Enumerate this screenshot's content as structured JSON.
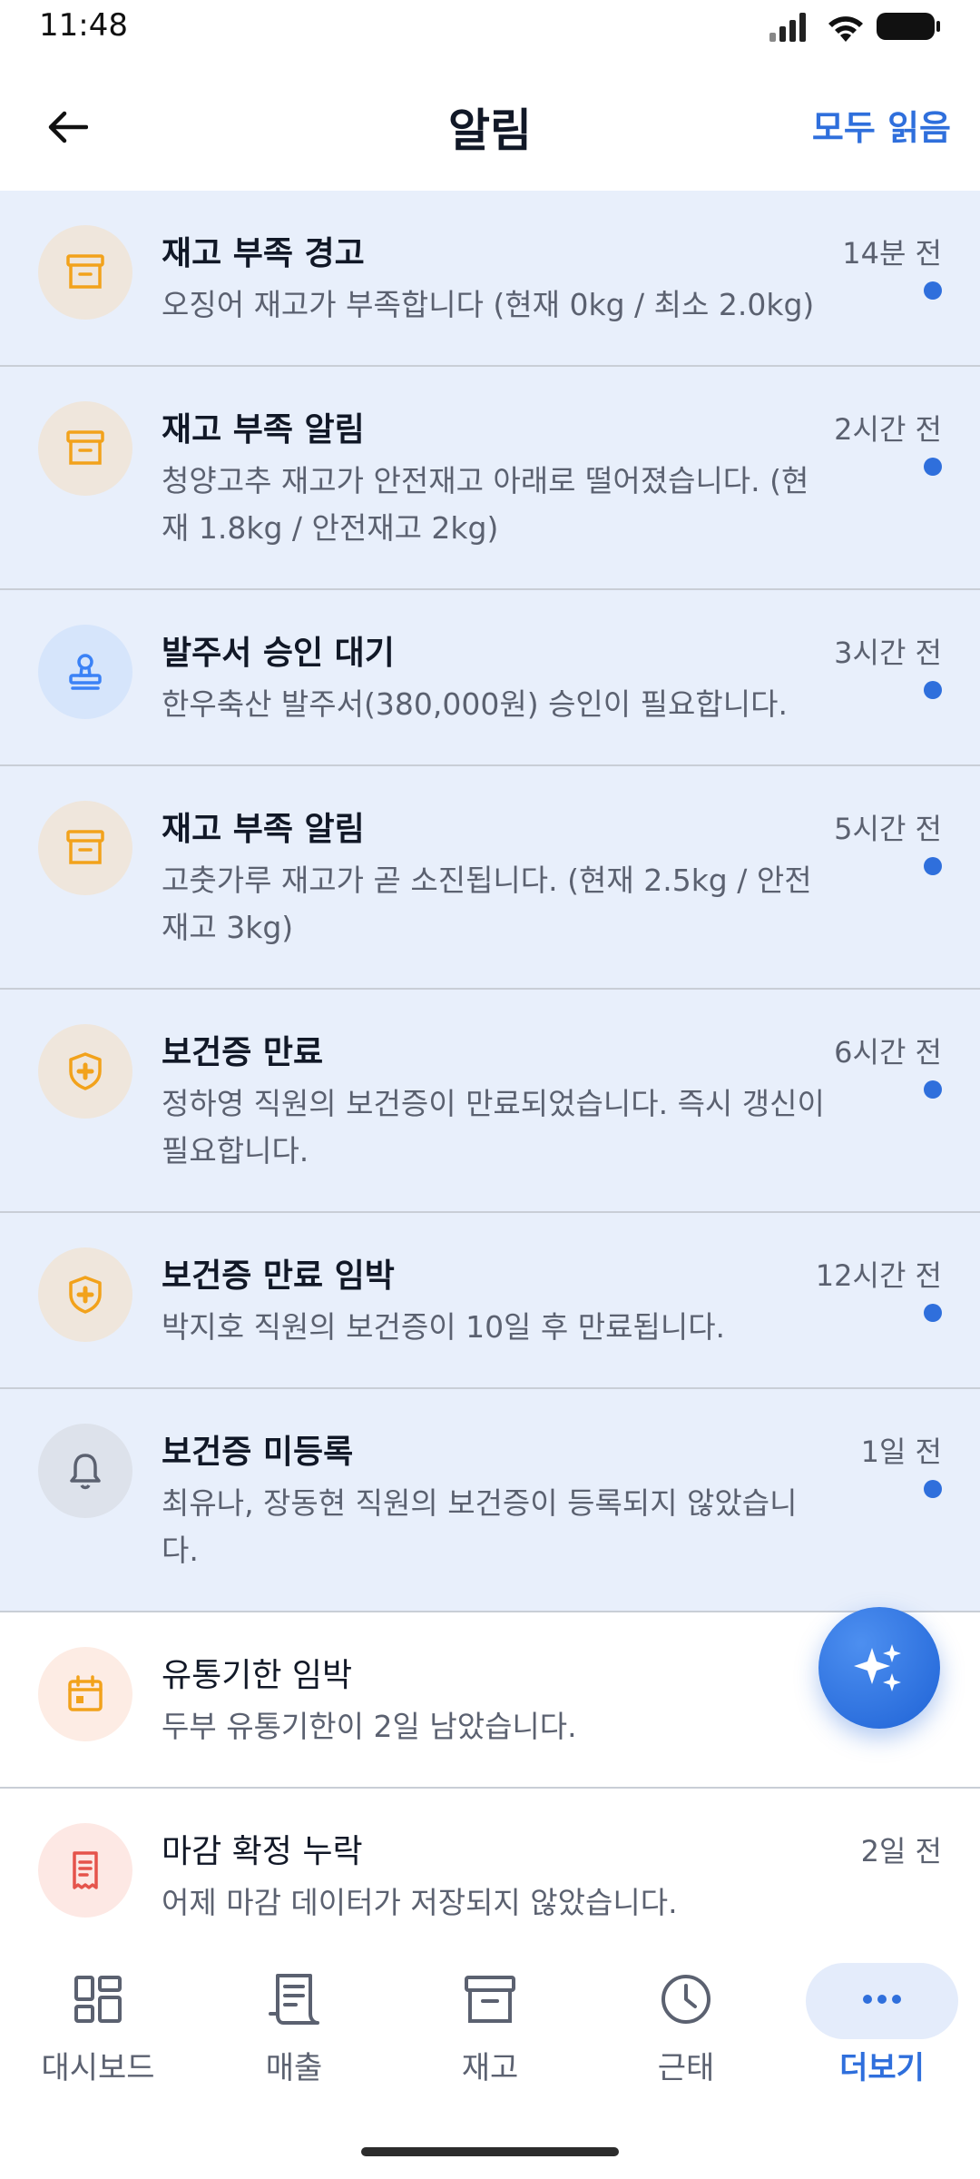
{
  "status": {
    "time": "11:48"
  },
  "appbar": {
    "title": "알림",
    "read_all": "모두 읽음"
  },
  "notifications": [
    {
      "title": "재고 부족 경고",
      "message": "오징어 재고가 부족합니다 (현재 0kg / 최소 2.0kg)",
      "time": "14분 전",
      "icon": "archive-icon",
      "state": "unread"
    },
    {
      "title": "재고 부족 알림",
      "message": "청양고추 재고가 안전재고 아래로 떨어졌습니다. (현재 1.8kg / 안전재고 2kg)",
      "time": "2시간 전",
      "icon": "archive-icon",
      "state": "unread"
    },
    {
      "title": "발주서 승인 대기",
      "message": "한우축산 발주서(380,000원) 승인이 필요합니다.",
      "time": "3시간 전",
      "icon": "stamp-icon",
      "state": "unread"
    },
    {
      "title": "재고 부족 알림",
      "message": "고춧가루 재고가 곧 소진됩니다. (현재 2.5kg / 안전재고 3kg)",
      "time": "5시간 전",
      "icon": "archive-icon",
      "state": "unread"
    },
    {
      "title": "보건증 만료",
      "message": "정하영 직원의 보건증이 만료되었습니다. 즉시 갱신이 필요합니다.",
      "time": "6시간 전",
      "icon": "shield-plus-icon",
      "state": "unread"
    },
    {
      "title": "보건증 만료 임박",
      "message": "박지호 직원의 보건증이 10일 후 만료됩니다.",
      "time": "12시간 전",
      "icon": "shield-plus-icon",
      "state": "unread"
    },
    {
      "title": "보건증 미등록",
      "message": "최유나, 장동현 직원의 보건증이 등록되지 않았습니다.",
      "time": "1일 전",
      "icon": "bell-icon",
      "state": "unread"
    },
    {
      "title": "유통기한 임박",
      "message": "두부 유통기한이 2일 남았습니다.",
      "time": "",
      "icon": "calendar-icon",
      "state": "read"
    },
    {
      "title": "마감 확정 누락",
      "message": "어제 마감 데이터가 저장되지 않았습니다.",
      "time": "2일 전",
      "icon": "receipt-icon",
      "state": "read"
    }
  ],
  "bottom_nav": [
    {
      "label": "대시보드",
      "icon": "dashboard-icon"
    },
    {
      "label": "매출",
      "icon": "receipt-icon"
    },
    {
      "label": "재고",
      "icon": "archive-icon"
    },
    {
      "label": "근태",
      "icon": "clock-icon"
    },
    {
      "label": "더보기",
      "icon": "more-icon",
      "active": true
    }
  ],
  "colors": {
    "accent": "#2f6fdc",
    "unread_bg": "#e8effb",
    "orange": "#f2a21b",
    "red": "#e5534b",
    "stamp_blue": "#3b82f6",
    "gray_icon": "#5b6170"
  }
}
